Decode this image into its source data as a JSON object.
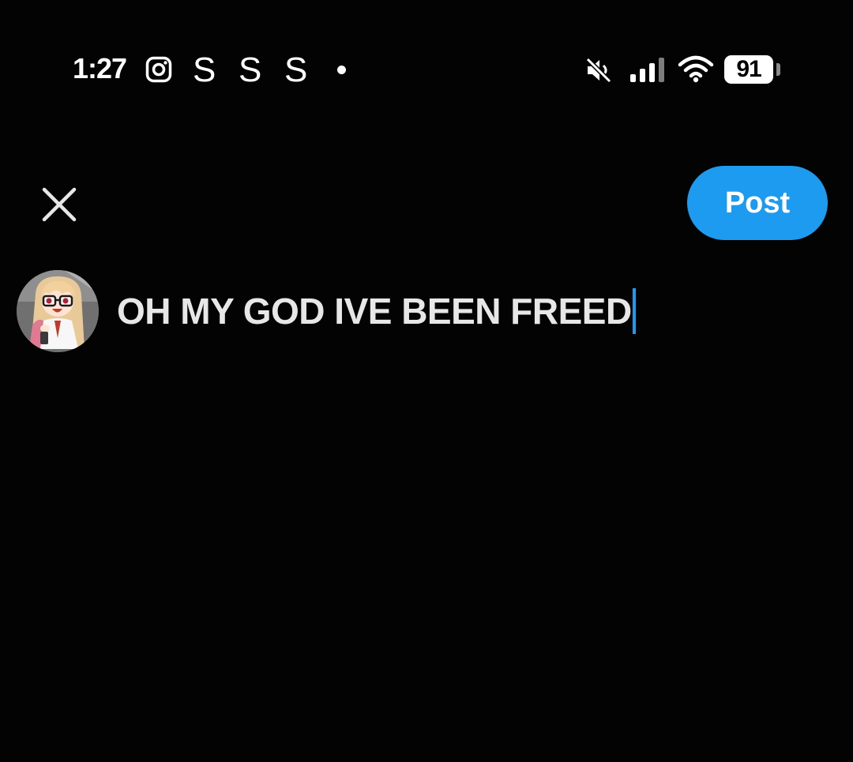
{
  "status_bar": {
    "time": "1:27",
    "notification_icons": [
      "instagram-icon",
      "s-app-icon",
      "s-app-icon",
      "s-app-icon",
      "more-notifications-dot"
    ],
    "s_glyphs": [
      "S",
      "S",
      "S"
    ],
    "mute": true,
    "battery_level": "91"
  },
  "composer": {
    "post_button_label": "Post",
    "text": "OH MY GOD IVE BEEN FREED"
  },
  "colors": {
    "background": "#030303",
    "accent": "#1d9bf0",
    "text": "#e7e7e7"
  }
}
